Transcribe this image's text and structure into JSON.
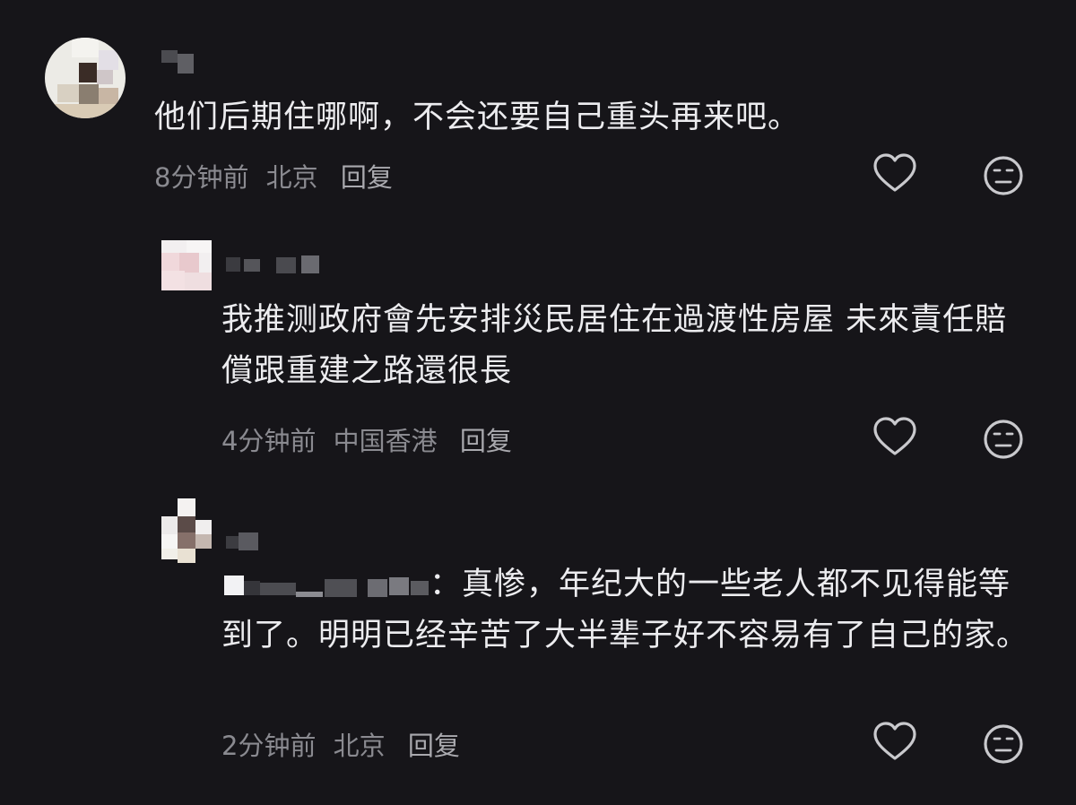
{
  "comments": [
    {
      "text": "他们后期住哪啊，不会还要自己重头再来吧。",
      "time": "8分钟前",
      "location": "北京",
      "reply_label": "回复"
    },
    {
      "text": "我推测政府會先安排災民居住在過渡性房屋 未來責任賠償跟重建之路還很長",
      "time": "4分钟前",
      "location": "中国香港",
      "reply_label": "回复"
    },
    {
      "text": "：真惨，年纪大的一些老人都不见得能等到了。明明已经辛苦了大半辈子好不容易有了自己的家。",
      "time": "2分钟前",
      "location": "北京",
      "reply_label": "回复"
    }
  ],
  "icons": {
    "like": "heart-outline-icon",
    "reaction": "meh-face-icon"
  },
  "colors": {
    "background": "#161519",
    "text": "#ececef",
    "meta": "#8a8a90",
    "icon": "#c9c9cd"
  }
}
